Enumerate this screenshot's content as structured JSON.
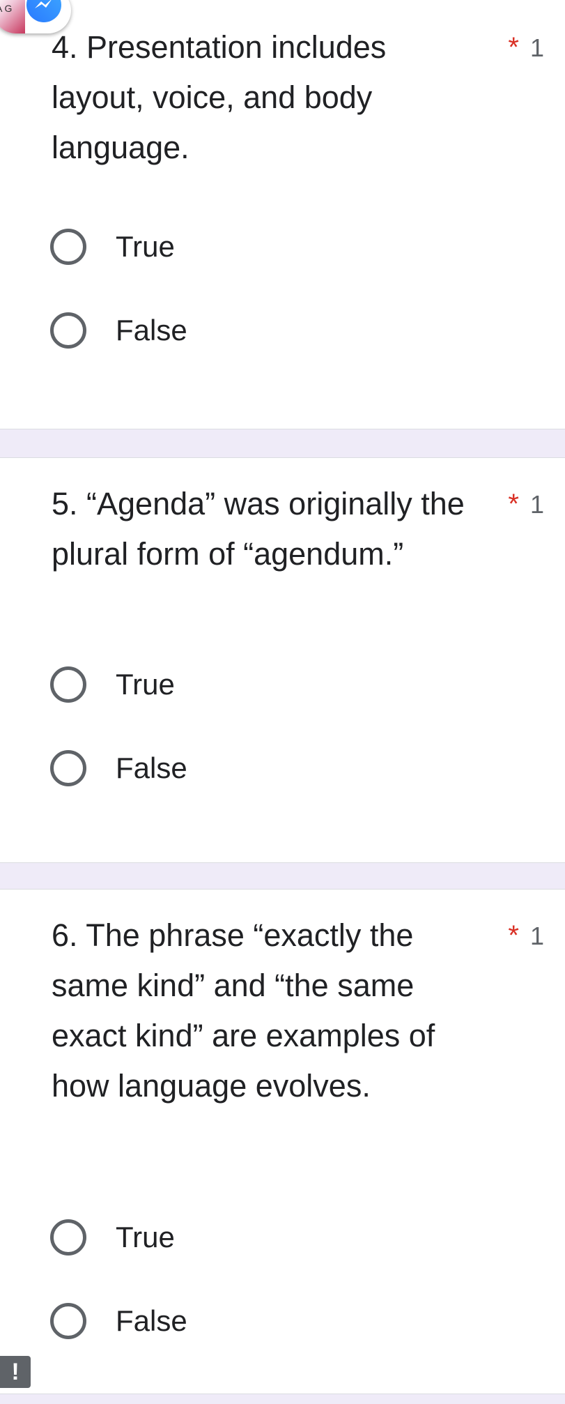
{
  "questions": [
    {
      "text": "4.  Presentation includes layout, voice, and body language.",
      "required_mark": "*",
      "points": "1",
      "options": [
        "True",
        "False"
      ]
    },
    {
      "text": "5.  “Agenda” was originally the plural form of “agendum.”",
      "required_mark": "*",
      "points": "1",
      "options": [
        "True",
        "False"
      ]
    },
    {
      "text": "6.  The phrase “exactly the same kind” and “the same exact kind” are examples of how language evolves.",
      "required_mark": "*",
      "points": "1",
      "options": [
        "True",
        "False"
      ]
    }
  ],
  "chat_bubble": {
    "thumbnail_text": "A\nG",
    "icon": "messenger-icon"
  },
  "error_badge": {
    "text": "!"
  },
  "colors": {
    "background": "#efebf8",
    "required": "#d93025",
    "radio_border": "#5f6368",
    "messenger": "#2979ff"
  }
}
